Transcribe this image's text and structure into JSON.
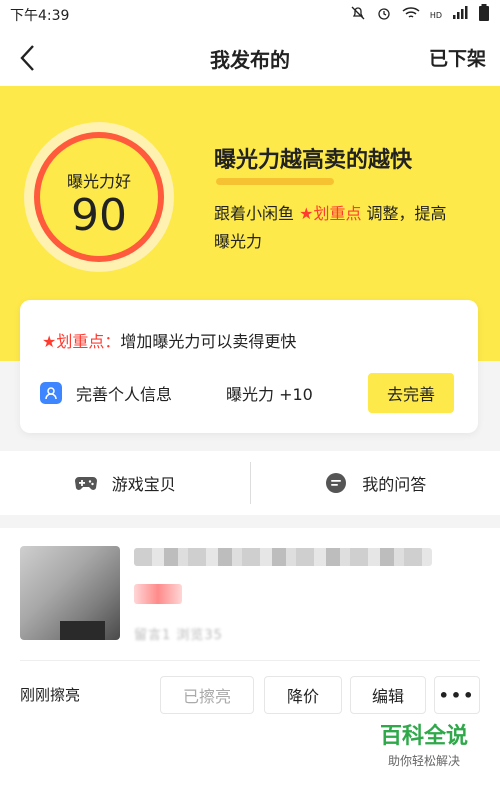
{
  "statusbar": {
    "time": "下午4:39",
    "network": "HD"
  },
  "nav": {
    "title": "我发布的",
    "right_link": "已下架"
  },
  "hero": {
    "ring_label": "曝光力好",
    "score": "90",
    "heading": "曝光力越高卖的越快",
    "desc_pre": "跟着小闲鱼 ",
    "desc_highlight": "★划重点",
    "desc_post": " 调整，提高曝光力",
    "accent_color": "#fde94a",
    "ring_color": "#ff5a3c"
  },
  "tip_card": {
    "tip_prefix": "★划重点：",
    "tip_text": "增加曝光力可以卖得更快",
    "action_label": "完善个人信息",
    "bonus": "曝光力 +10",
    "button": "去完善"
  },
  "quicklinks": [
    {
      "label": "游戏宝贝",
      "icon": "gamepad-icon"
    },
    {
      "label": "我的问答",
      "icon": "chat-icon"
    }
  ],
  "item": {
    "stats": "留言1 浏览35"
  },
  "actions": {
    "refresh_time": "刚刚擦亮",
    "refreshed": "已擦亮",
    "price_cut": "降价",
    "edit": "编辑",
    "more": "•••"
  },
  "watermark": {
    "title": "百科全说",
    "subtitle": "助你轻松解决"
  }
}
